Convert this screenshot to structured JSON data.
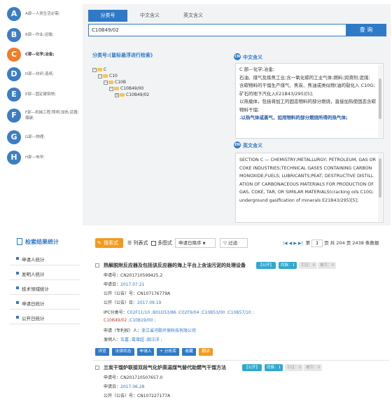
{
  "sections": [
    {
      "letter": "A",
      "label": "A部—人类生活必需;"
    },
    {
      "letter": "B",
      "label": "B部—作业;运输;"
    },
    {
      "letter": "C",
      "label": "C部—化学;冶金;",
      "active": true
    },
    {
      "letter": "D",
      "label": "D部—纺织;造纸;"
    },
    {
      "letter": "E",
      "label": "E部—固定建筑物;"
    },
    {
      "letter": "F",
      "label": "F部—机械工程;照明;加热;武器;爆破;"
    },
    {
      "letter": "G",
      "label": "G部—物理;"
    },
    {
      "letter": "H",
      "label": "H部—电学;"
    }
  ],
  "tabs": [
    "分类号",
    "中文含义",
    "英文含义"
  ],
  "search": {
    "value": "C10B49/02",
    "button": "查 询"
  },
  "tree": {
    "title": "分类号:(鼠标悬浮进行检索)",
    "nodes": [
      "C",
      "C10",
      "C10B",
      "C10B49/00",
      "C10B49/02"
    ]
  },
  "cn_def": {
    "badge": "CN",
    "heading": "中文含义",
    "lines": [
      "C 部—化学;冶金;",
      "石油、煤气及炼焦工业;含一氧化碳的工业气体;燃料;润滑剂;泥煤;",
      "含碳物料的干馏生产煤气、焦炭、焦油或类似物(油的裂化入 C10G;矿石的地下汽化入E21B43/295)[5];",
      "以热载体，包括将加工的固态物料的部分燃烧，直接加热使固态含碳物料干馏;"
    ],
    "highlight": ".以热气体或蒸气，如用物料的部分燃烧所得的热气体;"
  },
  "en_def": {
    "badge": "EN",
    "heading": "英文含义",
    "text": "SECTION C — CHEMISTRY;METALLURGY; PETROLEUM, GAS OR COKE INDUSTRIES;TECHNICAL GASES CONTAINING CARBON MONOXIDE;FUELS; LUBRICANTS;PEAT; DESTRUCTIVE DISTILLATION OF CARBONACEOUS MATERIALS FOR PRODUCTION OF GAS, COKE, TAR, OR SIMILAR MATERIALS(cracking oils C10G;underground gasification of minerals E21B43/295)[5];"
  },
  "stats": {
    "title": "检索结果统计",
    "items": [
      "申请人统计",
      "发明人统计",
      "技术领域统计",
      "申请日统计",
      "公开日统计"
    ]
  },
  "toolbar": {
    "search_style": "搜索式",
    "list_view": "列表式",
    "image_view": "多图式",
    "sort": "申请日降序",
    "filter": "过滤",
    "page_label_pre": "第",
    "page_value": "1",
    "page_label_post": "页 共 204 页 2438 条数据"
  },
  "records": [
    {
      "title": "热解脱附反应器及包括该反应器的海上平台上含油污泥的处理设备",
      "status": "【公开】",
      "family": "同族：1",
      "cite": "引证：0",
      "cited": "被引：0",
      "app_no_label": "申请号：",
      "app_no": "CN201710599425.2",
      "app_date_label": "申请日：",
      "app_date": "2017.07.21",
      "pub_no_label": "公开（公告）号：",
      "pub_no": "CN107176779A",
      "pub_date_label": "公开（公告）日：",
      "pub_date": "2017.09.19",
      "ipc_label": "IPC分类号：",
      "ipc": "C02F11/10 ;B01D53/86 ;C02F9/04 ;C10B53/00 ;C10B57/10 ;",
      "ipc_hl": "C10B49/02",
      "ipc_rest": " ;C10B19/00 ;",
      "applicant_label": "申请（专利权）人：",
      "applicant": "浙江省河歌环保科技有限公司",
      "inventor_label": "发明人：",
      "inventor": "车嘉 ;葛增超 ;田汪洋 ;",
      "actions": [
        "详览",
        "法律状态",
        "申请人",
        "+ 分析库",
        "收藏",
        "翻译"
      ]
    },
    {
      "title": "兰炭干馏炉联接双段气化炉高温煤气替代助燃气干馏方法",
      "status": "【公开】",
      "family": "同族：1",
      "cite": "引证：0",
      "cited": "被引：0",
      "app_no_label": "申请号：",
      "app_no": "CN201710507657.0",
      "app_date_label": "申请日：",
      "app_date": "2017.06.28",
      "pub_no_label": "公开（公告）号：",
      "pub_no": "CN107227177A"
    }
  ]
}
